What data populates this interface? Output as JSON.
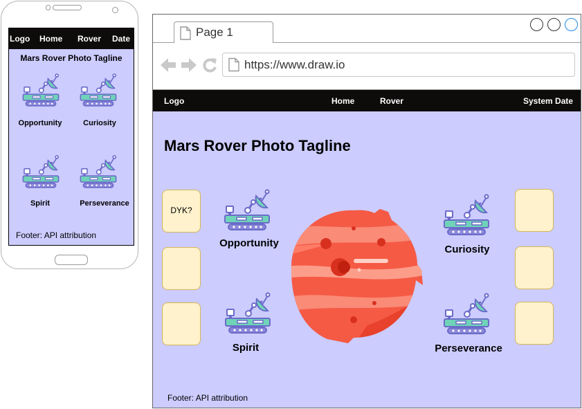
{
  "mobile": {
    "nav": {
      "logo": "Logo",
      "home": "Home",
      "rover": "Rover",
      "date": "Date"
    },
    "tagline": "Mars Rover Photo Tagline",
    "rovers": [
      "Opportunity",
      "Curiosity",
      "Spirit",
      "Perseverance"
    ],
    "footer": "Footer: API attribution"
  },
  "browser": {
    "tab_label": "Page 1",
    "url": "https://www.draw.io",
    "nav": {
      "logo": "Logo",
      "home": "Home",
      "rover": "Rover",
      "system_date": "System Date"
    },
    "tagline": "Mars Rover Photo Tagline",
    "rovers": [
      "Opportunity",
      "Curiosity",
      "Spirit",
      "Perseverance"
    ],
    "dyk_card": "DYK?",
    "footer": "Footer: API attribution"
  },
  "colors": {
    "page_bg": "#ccccff",
    "nav_bg": "#0e0b0b",
    "card_fill": "#fff2cc",
    "card_border": "#d6b656",
    "mars_main": "#f55a45",
    "window_button_accent": "#1e88e5"
  },
  "icons": [
    "rover-icon",
    "mars-planet-icon",
    "back-arrow-icon",
    "forward-arrow-icon",
    "reload-icon",
    "page-icon"
  ]
}
